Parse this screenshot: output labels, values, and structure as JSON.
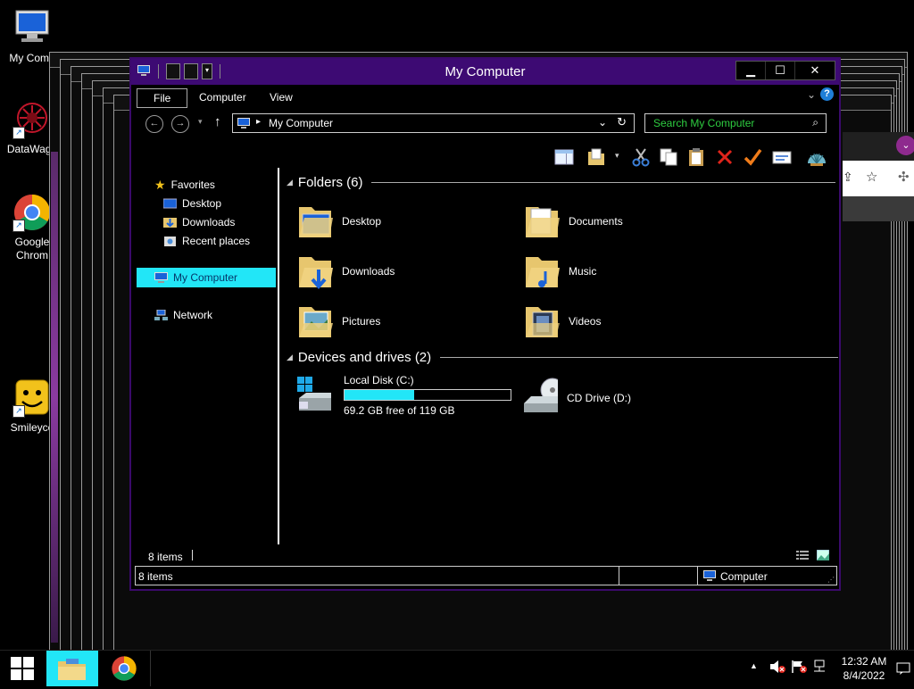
{
  "desktop": {
    "icons": [
      {
        "label": "My Comp",
        "icon": "computer-icon"
      },
      {
        "label": "DataWago",
        "icon": "datawagon-icon"
      },
      {
        "label": "Google Chrom",
        "icon": "chrome-icon"
      },
      {
        "label": "Smileyco",
        "icon": "smiley-icon"
      }
    ]
  },
  "window": {
    "title": "My Computer",
    "ribbon_tabs": [
      "File",
      "Computer",
      "View"
    ],
    "address": "My Computer",
    "search_placeholder": "Search My Computer"
  },
  "nav": {
    "favorites": "Favorites",
    "fav_items": [
      "Desktop",
      "Downloads",
      "Recent places"
    ],
    "selected": "My Computer",
    "network": "Network"
  },
  "content": {
    "folders_header": "Folders (6)",
    "folders": [
      "Desktop",
      "Documents",
      "Downloads",
      "Music",
      "Pictures",
      "Videos"
    ],
    "devices_header": "Devices and drives (2)",
    "drives": [
      {
        "name": "Local Disk (C:)",
        "free_text": "69.2 GB free of 119 GB",
        "used_fraction": 0.42
      },
      {
        "name": "CD Drive (D:)"
      }
    ]
  },
  "status": {
    "items_count": "8 items",
    "bar_items": "8 items",
    "bar_location": "Computer"
  },
  "taskbar": {
    "time": "12:32 AM",
    "date": "8/4/2022"
  },
  "colors": {
    "titlebar": "#3d0a73",
    "selection": "#22e6f7",
    "drive_fill": "#22e6f7",
    "search_text": "#2ecc40"
  }
}
